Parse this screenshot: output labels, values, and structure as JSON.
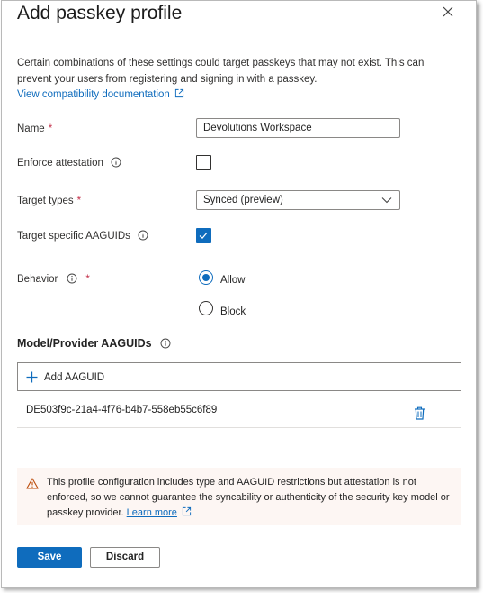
{
  "dialog": {
    "title": "Add passkey profile",
    "close_icon": "close-icon"
  },
  "description": "Certain combinations of these settings could target passkeys that may not exist. This can prevent your users from registering and signing in with a passkey.",
  "compat_link": {
    "label": "View compatibility documentation",
    "icon": "external-link-icon"
  },
  "form": {
    "required_marker": "*",
    "name": {
      "label": "Name",
      "value": "Devolutions Workspace",
      "required": true
    },
    "enforce_attestation": {
      "label": "Enforce attestation",
      "checked": false,
      "info_icon": "info-icon"
    },
    "target_types": {
      "label": "Target types",
      "value": "Synced (preview)",
      "required": true,
      "icon": "chevron-down-icon"
    },
    "target_specific_aaguids": {
      "label": "Target specific AAGUIDs",
      "checked": true,
      "info_icon": "info-icon"
    },
    "behavior": {
      "label": "Behavior",
      "required": true,
      "info_icon": "info-icon",
      "options": [
        {
          "label": "Allow",
          "selected": true
        },
        {
          "label": "Block",
          "selected": false
        }
      ]
    }
  },
  "aaguids": {
    "title": "Model/Provider AAGUIDs",
    "info_icon": "info-icon",
    "add_label": "Add AAGUID",
    "add_icon": "plus-icon",
    "items": [
      {
        "value": "DE503f9c-21a4-4f76-b4b7-558eb55c6f89",
        "delete_icon": "trash-icon"
      }
    ]
  },
  "warning": {
    "icon": "warning-icon",
    "text": "This profile configuration includes type and AAGUID restrictions but attestation is not enforced, so we cannot guarantee the syncability or authenticity of the security key model or passkey provider.",
    "link_label": "Learn more",
    "link_icon": "external-link-icon"
  },
  "footer": {
    "save_label": "Save",
    "discard_label": "Discard"
  },
  "colors": {
    "accent": "#0f6cbd",
    "required": "#c4314b",
    "warning_bg": "#fdf6f3",
    "warning_icon": "#bc4b09"
  }
}
